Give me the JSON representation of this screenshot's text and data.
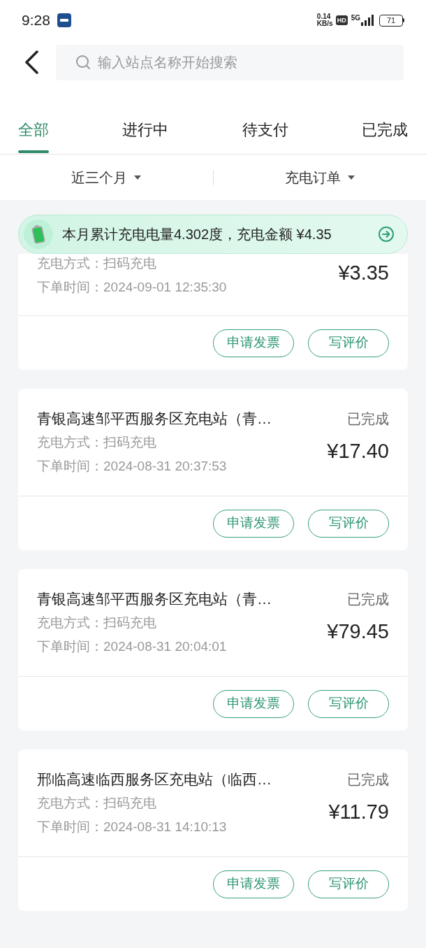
{
  "status_bar": {
    "time": "9:28",
    "net_speed": "0.14",
    "net_unit": "KB/s",
    "hd": "HD",
    "network": "5G",
    "battery": "71"
  },
  "search": {
    "placeholder": "输入站点名称开始搜索"
  },
  "tabs": [
    {
      "label": "全部",
      "selected": true
    },
    {
      "label": "进行中",
      "selected": false
    },
    {
      "label": "待支付",
      "selected": false
    },
    {
      "label": "已完成",
      "selected": false
    }
  ],
  "filters": [
    {
      "label": "近三个月"
    },
    {
      "label": "充电订单"
    }
  ],
  "summary_banner": {
    "text": "本月累计充电电量4.302度，充电金额 ¥4.35"
  },
  "orders": [
    {
      "method": "充电方式：扫码充电",
      "time": "下单时间：2024-09-01 12:35:30",
      "amount": "¥3.35",
      "buttons": [
        "申请发票",
        "写评价"
      ]
    },
    {
      "station": "青银高速邹平西服务区充电站（青…",
      "status": "已完成",
      "method": "充电方式：扫码充电",
      "time": "下单时间：2024-08-31 20:37:53",
      "amount": "¥17.40",
      "buttons": [
        "申请发票",
        "写评价"
      ]
    },
    {
      "station": "青银高速邹平西服务区充电站（青…",
      "status": "已完成",
      "method": "充电方式：扫码充电",
      "time": "下单时间：2024-08-31 20:04:01",
      "amount": "¥79.45",
      "buttons": [
        "申请发票",
        "写评价"
      ]
    },
    {
      "station": "邢临高速临西服务区充电站（临西…",
      "status": "已完成",
      "method": "充电方式：扫码充电",
      "time": "下单时间：2024-08-31 14:10:13",
      "amount": "¥11.79",
      "buttons": [
        "申请发票",
        "写评价"
      ]
    }
  ]
}
